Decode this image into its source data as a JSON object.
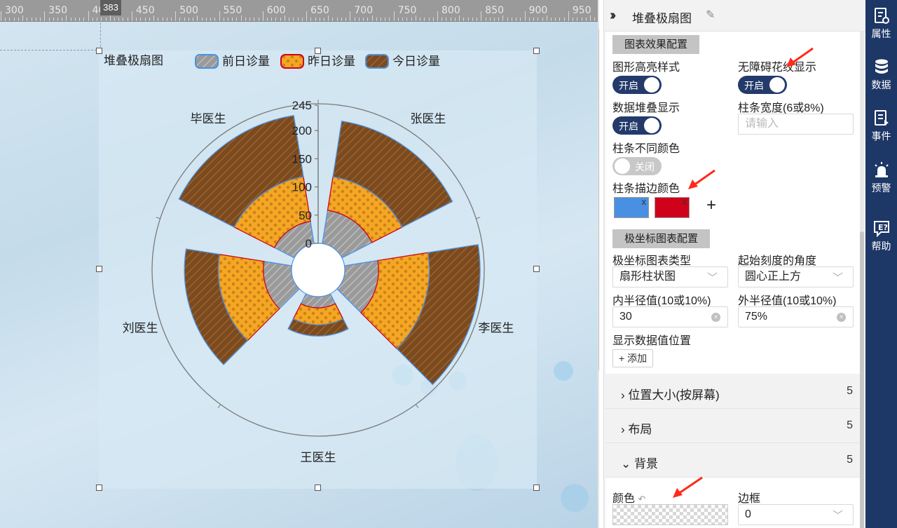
{
  "ruler": {
    "labels": [
      "300",
      "350",
      "400",
      "450",
      "500",
      "550",
      "600",
      "650",
      "700",
      "750",
      "800",
      "850",
      "900",
      "950"
    ],
    "marker": "383"
  },
  "chart_data": {
    "type": "stacked-polar-bar",
    "title": "堆叠极扇图",
    "categories": [
      "张医生",
      "李医生",
      "王医生",
      "刘医生",
      "毕医生"
    ],
    "series": [
      {
        "name": "前日诊量",
        "values": [
          60,
          60,
          20,
          50,
          40
        ],
        "fill": "#9a9a9a",
        "pattern": "hatch-gray",
        "stroke": "#4a90e2"
      },
      {
        "name": "昨日诊量",
        "values": [
          60,
          90,
          30,
          80,
          80
        ],
        "fill": "#f5a623",
        "pattern": "dots",
        "stroke": "#d0021b"
      },
      {
        "name": "今日诊量",
        "values": [
          100,
          90,
          20,
          60,
          110
        ],
        "fill": "#7b4a1e",
        "pattern": "hatch-brown",
        "stroke": "#4a90e2"
      }
    ],
    "radial_axis": {
      "min": 0,
      "max": 245,
      "ticks": [
        0,
        50,
        100,
        150,
        200,
        245
      ]
    },
    "start_angle": "top",
    "inner_radius": "30",
    "outer_radius": "75%",
    "legend_position": "top"
  },
  "panel": {
    "title": "堆叠极扇图",
    "section_effect": "图表效果配置",
    "highlight_style_label": "图形高亮样式",
    "highlight_style_toggle": "开启",
    "accessible_pattern_label": "无障碍花纹显示",
    "accessible_pattern_toggle": "开启",
    "stack_label": "数据堆叠显示",
    "stack_toggle": "开启",
    "bar_width_label": "柱条宽度(6或8%)",
    "bar_width_placeholder": "请输入",
    "diff_color_label": "柱条不同颜色",
    "diff_color_toggle": "关闭",
    "stroke_color_label": "柱条描边颜色",
    "stroke_colors": [
      "#4a90e2",
      "#d0021b"
    ],
    "add_symbol": "+",
    "section_polar": "极坐标图表配置",
    "polar_type_label": "极坐标图表类型",
    "polar_type_value": "扇形柱状图",
    "start_angle_label": "起始刻度的角度",
    "start_angle_value": "圆心正上方",
    "inner_radius_label": "内半径值(10或10%)",
    "inner_radius_value": "30",
    "outer_radius_label": "外半径值(10或10%)",
    "outer_radius_value": "75%",
    "data_position_label": "显示数据值位置",
    "add_button": "+ 添加",
    "collapse_rows": [
      {
        "label": "位置大小(按屏幕)",
        "count": "5",
        "state": "collapsed"
      },
      {
        "label": "布局",
        "count": "5",
        "state": "collapsed"
      },
      {
        "label": "背景",
        "count": "5",
        "state": "expanded"
      }
    ],
    "bg_color_label": "颜色",
    "border_label": "边框",
    "border_value": "0"
  },
  "side_nav": [
    {
      "label": "属性",
      "icon": "properties-icon"
    },
    {
      "label": "数据",
      "icon": "database-icon"
    },
    {
      "label": "事件",
      "icon": "event-icon"
    },
    {
      "label": "预警",
      "icon": "alarm-icon"
    },
    {
      "label": "帮助",
      "icon": "help-icon"
    }
  ],
  "colors": {
    "nav_bg": "#1d3766",
    "toggle_on": "#233a6b",
    "annotation_arrow": "#ff2a1a"
  }
}
